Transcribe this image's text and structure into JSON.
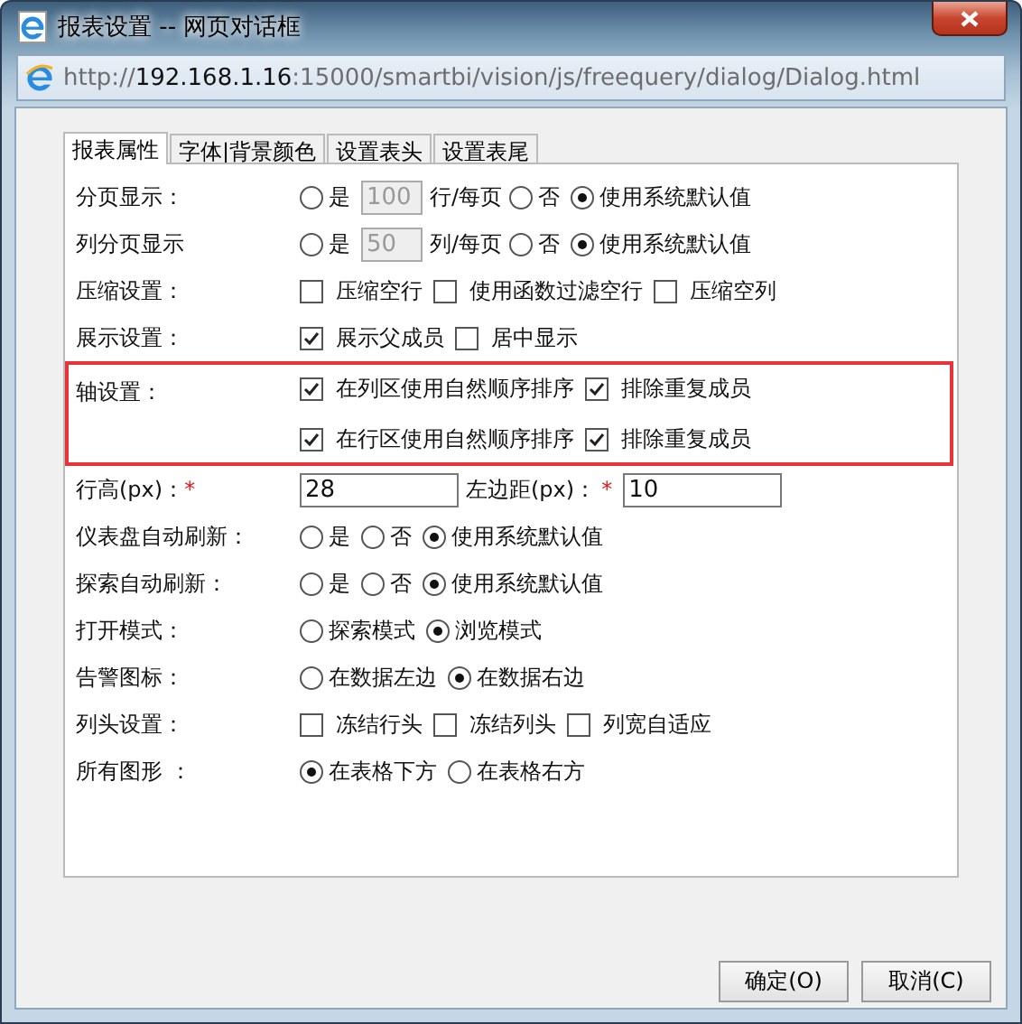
{
  "window": {
    "title": "报表设置 -- 网页对话框"
  },
  "address_bar": {
    "scheme": "http://",
    "host": "192.168.1.16",
    "path": ":15000/smartbi/vision/js/freequery/dialog/Dialog.html"
  },
  "tabs": [
    {
      "label": "报表属性",
      "selected": true
    },
    {
      "label": "字体|背景颜色",
      "selected": false
    },
    {
      "label": "设置表头",
      "selected": false
    },
    {
      "label": "设置表尾",
      "selected": false
    }
  ],
  "rows": [
    {
      "label": "分页显示：",
      "highlighted": false,
      "lines": [
        [
          {
            "kind": "radio",
            "label": "是",
            "selected": false
          },
          {
            "kind": "field",
            "value": "100",
            "disabled": true
          },
          {
            "kind": "text",
            "text": "行/每页"
          },
          {
            "kind": "radio",
            "label": "否",
            "selected": false
          },
          {
            "kind": "radio",
            "label": "使用系统默认值",
            "selected": true
          }
        ]
      ]
    },
    {
      "label": "列分页显示",
      "highlighted": false,
      "lines": [
        [
          {
            "kind": "radio",
            "label": "是",
            "selected": false
          },
          {
            "kind": "field",
            "value": "50",
            "disabled": true
          },
          {
            "kind": "text",
            "text": "列/每页"
          },
          {
            "kind": "radio",
            "label": "否",
            "selected": false
          },
          {
            "kind": "radio",
            "label": "使用系统默认值",
            "selected": true
          }
        ]
      ]
    },
    {
      "label": "压缩设置：",
      "highlighted": false,
      "lines": [
        [
          {
            "kind": "checkbox",
            "label": "压缩空行",
            "checked": false
          },
          {
            "kind": "checkbox",
            "label": "使用函数过滤空行",
            "checked": false
          },
          {
            "kind": "checkbox",
            "label": "压缩空列",
            "checked": false
          }
        ]
      ]
    },
    {
      "label": "展示设置：",
      "highlighted": false,
      "lines": [
        [
          {
            "kind": "checkbox",
            "label": "展示父成员",
            "checked": true
          },
          {
            "kind": "checkbox",
            "label": "居中显示",
            "checked": false
          }
        ]
      ]
    },
    {
      "label": "轴设置：",
      "highlighted": true,
      "lines": [
        [
          {
            "kind": "checkbox",
            "label": "在列区使用自然顺序排序",
            "checked": true
          },
          {
            "kind": "checkbox",
            "label": "排除重复成员",
            "checked": true
          }
        ],
        [
          {
            "kind": "checkbox",
            "label": "在行区使用自然顺序排序",
            "checked": true
          },
          {
            "kind": "checkbox",
            "label": "排除重复成员",
            "checked": true
          }
        ]
      ]
    },
    {
      "label": "行高(px)：",
      "marker": "*",
      "highlighted": false,
      "lines": [
        [
          {
            "kind": "field",
            "value": "28",
            "disabled": false
          },
          {
            "kind": "label",
            "text": "左边距(px)：",
            "marker": "*"
          },
          {
            "kind": "field",
            "value": "10",
            "disabled": false
          }
        ]
      ]
    },
    {
      "label": "仪表盘自动刷新：",
      "highlighted": false,
      "lines": [
        [
          {
            "kind": "radio",
            "label": "是",
            "selected": false
          },
          {
            "kind": "radio",
            "label": "否",
            "selected": false
          },
          {
            "kind": "radio",
            "label": "使用系统默认值",
            "selected": true
          }
        ]
      ]
    },
    {
      "label": "探索自动刷新：",
      "highlighted": false,
      "lines": [
        [
          {
            "kind": "radio",
            "label": "是",
            "selected": false
          },
          {
            "kind": "radio",
            "label": "否",
            "selected": false
          },
          {
            "kind": "radio",
            "label": "使用系统默认值",
            "selected": true
          }
        ]
      ]
    },
    {
      "label": "打开模式：",
      "highlighted": false,
      "lines": [
        [
          {
            "kind": "radio",
            "label": "探索模式",
            "selected": false
          },
          {
            "kind": "radio",
            "label": "浏览模式",
            "selected": true
          }
        ]
      ]
    },
    {
      "label": "告警图标：",
      "highlighted": false,
      "lines": [
        [
          {
            "kind": "radio",
            "label": "在数据左边",
            "selected": false
          },
          {
            "kind": "radio",
            "label": "在数据右边",
            "selected": true
          }
        ]
      ]
    },
    {
      "label": "列头设置：",
      "highlighted": false,
      "lines": [
        [
          {
            "kind": "checkbox",
            "label": "冻结行头",
            "checked": false
          },
          {
            "kind": "checkbox",
            "label": "冻结列头",
            "checked": false
          },
          {
            "kind": "checkbox",
            "label": "列宽自适应",
            "checked": false
          }
        ]
      ]
    },
    {
      "label": "所有图形 ：",
      "highlighted": false,
      "lines": [
        [
          {
            "kind": "radio",
            "label": "在表格下方",
            "selected": true
          },
          {
            "kind": "radio",
            "label": "在表格右方",
            "selected": false
          }
        ]
      ]
    }
  ],
  "buttons": [
    "确定(O)",
    "取消(C)"
  ]
}
